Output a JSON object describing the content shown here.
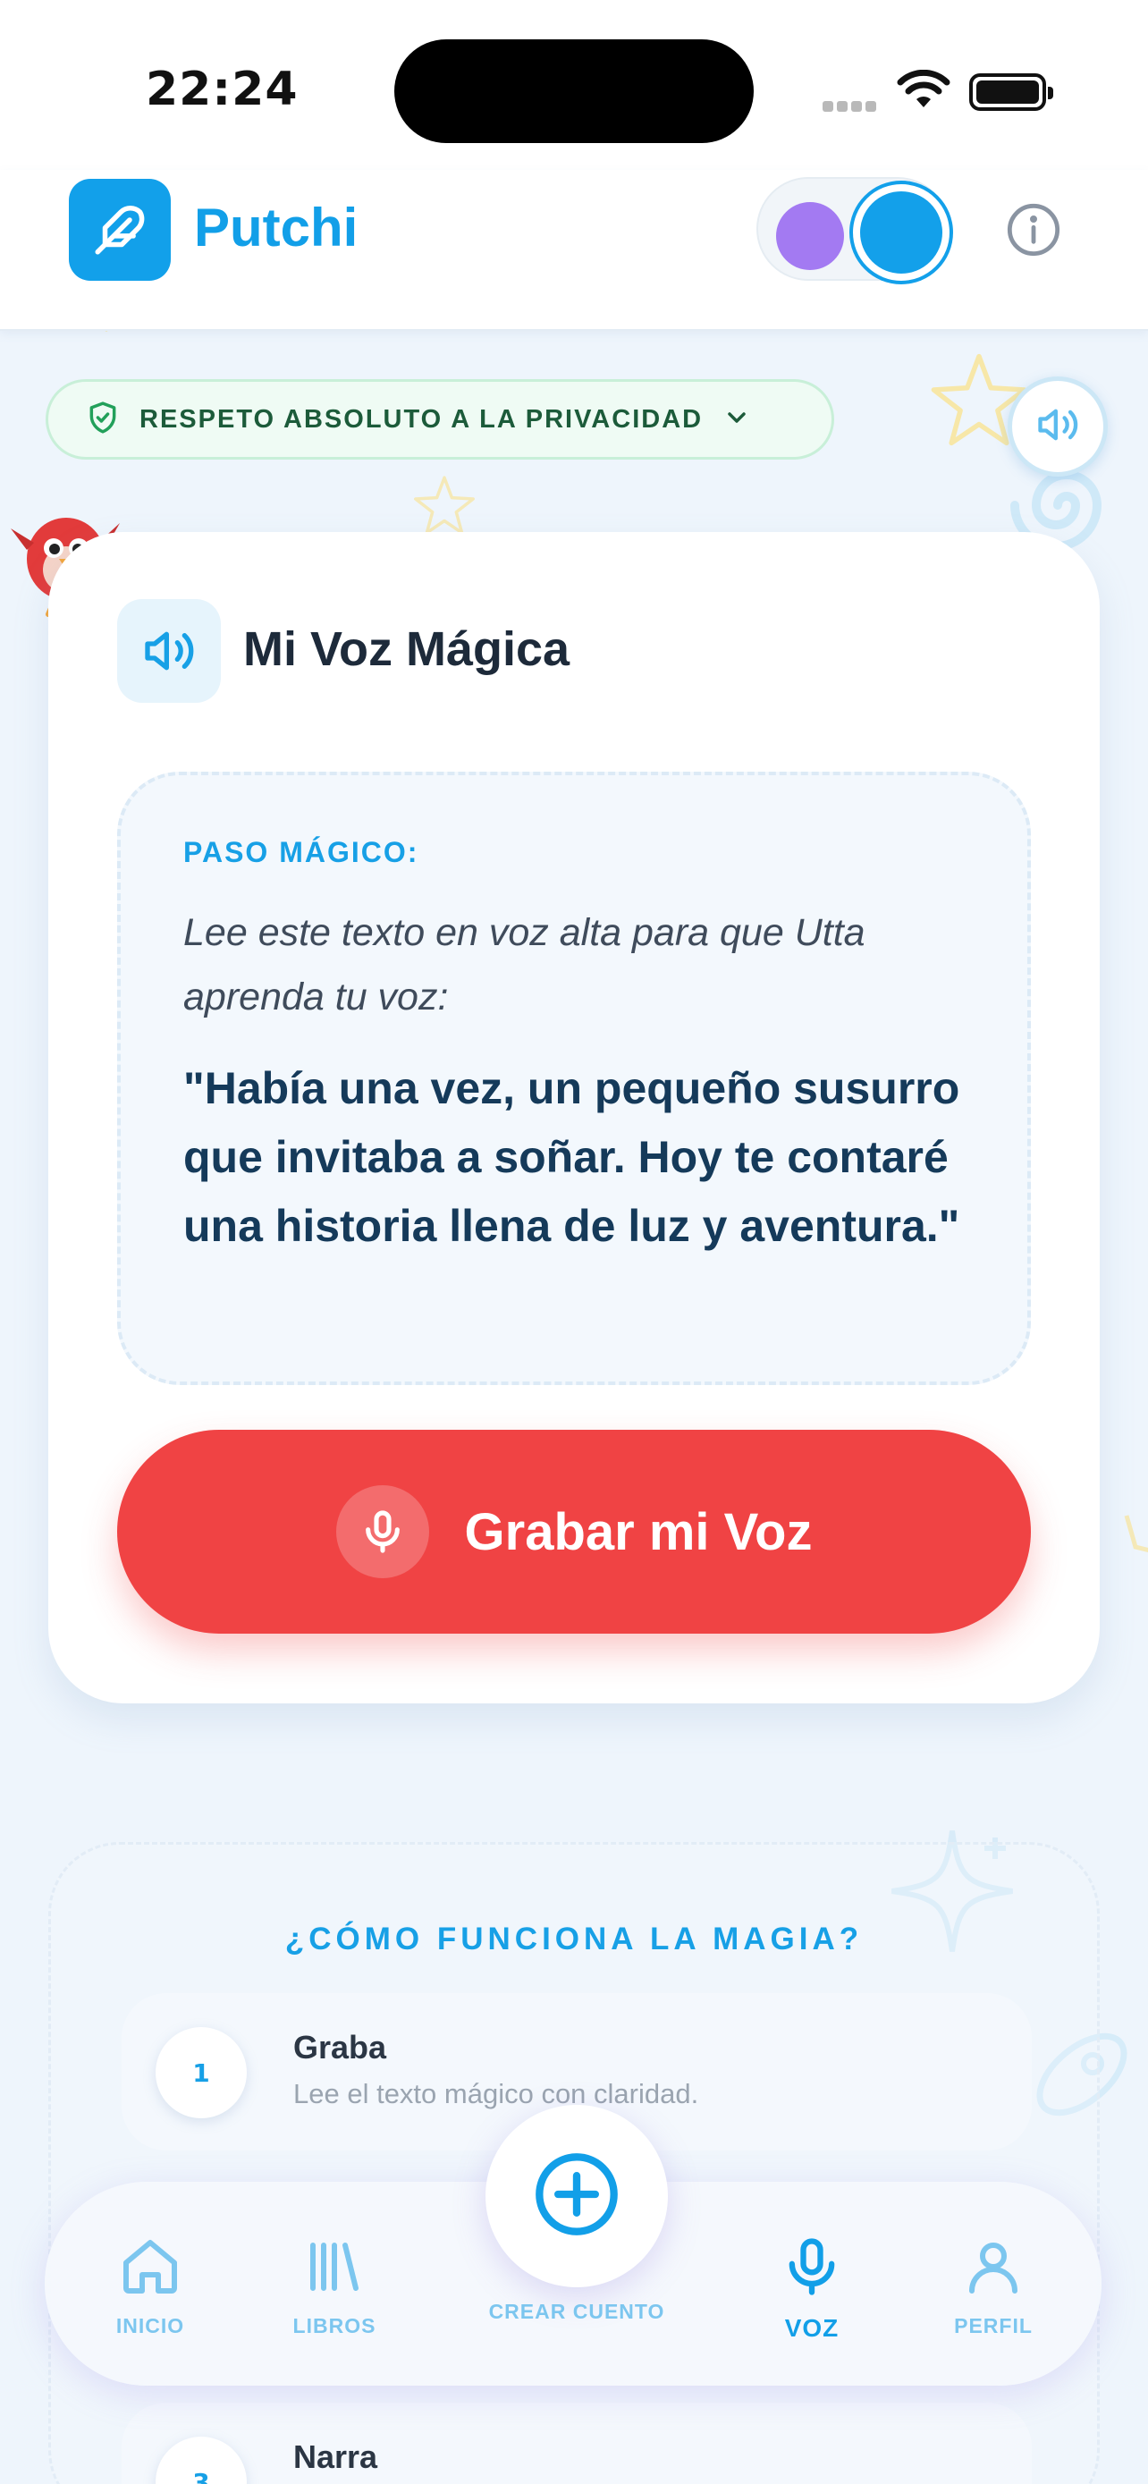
{
  "status_bar": {
    "time": "22:24"
  },
  "header": {
    "app_name": "Putchi",
    "logo_icon": "feather-icon",
    "info_icon": "info-icon"
  },
  "privacy": {
    "label": "RESPETO ABSOLUTO A LA PRIVACIDAD",
    "icon": "shield-check-icon"
  },
  "voice_card": {
    "title": "Mi Voz Mágica",
    "step_label": "PASO MÁGICO:",
    "instruction": "Lee este texto en voz alta para que Utta aprenda tu voz:",
    "quote": "\"Había una vez, un pequeño susurro que invitaba a soñar. Hoy te contaré una historia llena de luz y aventura.\"",
    "record_button": "Grabar mi Voz"
  },
  "how_it_works": {
    "title": "¿CÓMO FUNCIONA LA MAGIA?",
    "steps": [
      {
        "num": "1",
        "name": "Graba",
        "desc": "Lee el texto mágico con claridad."
      },
      {
        "num": "3",
        "name": "Narra",
        "desc": ""
      }
    ]
  },
  "nav": {
    "items": [
      {
        "label": "INICIO",
        "icon": "home-icon"
      },
      {
        "label": "LIBROS",
        "icon": "library-icon"
      },
      {
        "label": "CREAR CUENTO",
        "icon": "plus-circle-icon"
      },
      {
        "label": "VOZ",
        "icon": "mic-icon",
        "active": true
      },
      {
        "label": "PERFIL",
        "icon": "user-icon"
      }
    ]
  },
  "colors": {
    "brand_blue": "#129fe8",
    "record_red": "#f04344",
    "privacy_green": "#1c5b3a",
    "toggle_purple": "#a37af2"
  }
}
